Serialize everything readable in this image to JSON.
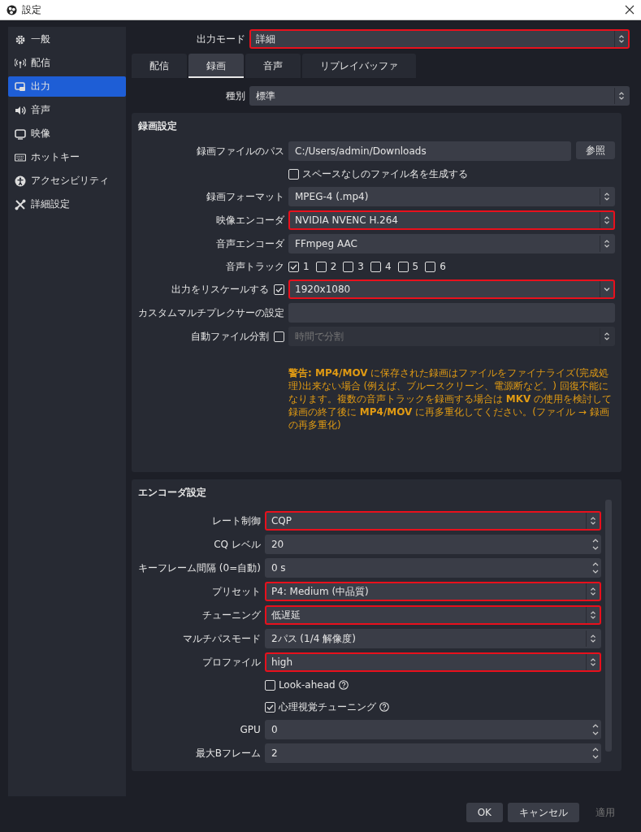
{
  "window": {
    "title": "設定"
  },
  "sidebar": {
    "items": [
      {
        "label": "一般",
        "selected": false
      },
      {
        "label": "配信",
        "selected": false
      },
      {
        "label": "出力",
        "selected": true
      },
      {
        "label": "音声",
        "selected": false
      },
      {
        "label": "映像",
        "selected": false
      },
      {
        "label": "ホットキー",
        "selected": false
      },
      {
        "label": "アクセシビリティ",
        "selected": false
      },
      {
        "label": "詳細設定",
        "selected": false
      }
    ]
  },
  "output_mode": {
    "label": "出力モード",
    "value": "詳細",
    "highlighted": true
  },
  "tabs": [
    {
      "label": "配信",
      "selected": false
    },
    {
      "label": "録画",
      "selected": true
    },
    {
      "label": "音声",
      "selected": false
    },
    {
      "label": "リプレイバッファ",
      "selected": false
    }
  ],
  "type": {
    "label": "種別",
    "value": "標準",
    "highlighted": false
  },
  "recording": {
    "title": "録画設定",
    "rows": [
      {
        "kind": "path",
        "label": "録画ファイルのパス",
        "value": "C:/Users/admin/Downloads",
        "button": "参照"
      },
      {
        "kind": "checkbox",
        "label": "スペースなしのファイル名を生成する",
        "checked": false
      },
      {
        "kind": "select",
        "label": "録画フォーマット",
        "value": "MPEG-4 (.mp4)",
        "highlighted": false
      },
      {
        "kind": "select",
        "label": "映像エンコーダ",
        "value": "NVIDIA NVENC H.264",
        "highlighted": true
      },
      {
        "kind": "select",
        "label": "音声エンコーダ",
        "value": "FFmpeg AAC",
        "highlighted": false
      },
      {
        "kind": "tracks",
        "label": "音声トラック",
        "tracks": [
          {
            "label": "1",
            "checked": true
          },
          {
            "label": "2",
            "checked": false
          },
          {
            "label": "3",
            "checked": false
          },
          {
            "label": "4",
            "checked": false
          },
          {
            "label": "5",
            "checked": false
          },
          {
            "label": "6",
            "checked": false
          }
        ]
      },
      {
        "kind": "combo",
        "label": "出力をリスケールする",
        "checked": true,
        "value": "1920x1080",
        "highlighted": true
      },
      {
        "kind": "text",
        "label": "カスタムマルチプレクサーの設定"
      },
      {
        "kind": "select",
        "label": "自動ファイル分割",
        "checked": false,
        "value": "時間で分割",
        "disabled": true,
        "highlighted": false
      },
      {
        "kind": "warning",
        "text": "**警告: MP4/MOV** に保存された録画はファイルをファイナライズ(完成処理)出来ない場合 (例えば、ブルースクリーン、電源断など。) 回復不能になります。複数の音声トラックを録画する場合は **MKV** の使用を検討して録画の終了後に **MP4/MOV** に再多重化してください。(ファイル → 録画の再多重化)"
      }
    ]
  },
  "encoder": {
    "title": "エンコーダ設定",
    "rows": [
      {
        "kind": "select",
        "label": "レート制御",
        "value": "CQP",
        "highlighted": true
      },
      {
        "kind": "spin",
        "label": "CQ レベル",
        "value": "20",
        "highlighted": false
      },
      {
        "kind": "spin",
        "label": "キーフレーム間隔 (0=自動)",
        "value": "0 s",
        "highlighted": false
      },
      {
        "kind": "select",
        "label": "プリセット",
        "value": "P4: Medium (中品質)",
        "highlighted": true
      },
      {
        "kind": "select",
        "label": "チューニング",
        "value": "低遅延",
        "highlighted": true
      },
      {
        "kind": "select",
        "label": "マルチパスモード",
        "value": "2パス (1/4 解像度)",
        "highlighted": false
      },
      {
        "kind": "select",
        "label": "プロファイル",
        "value": "high",
        "highlighted": true
      },
      {
        "kind": "checkbox",
        "label": "Look-ahead",
        "checked": false,
        "help": true
      },
      {
        "kind": "checkbox",
        "label": "心理視覚チューニング",
        "checked": true,
        "help": true
      },
      {
        "kind": "spin",
        "label": "GPU",
        "value": "0",
        "highlighted": false
      },
      {
        "kind": "spin",
        "label": "最大Bフレーム",
        "value": "2",
        "highlighted": false
      }
    ]
  },
  "buttons": [
    {
      "label": "OK",
      "disabled": false
    },
    {
      "label": "キャンセル",
      "disabled": false
    },
    {
      "label": "適用",
      "disabled": true
    }
  ]
}
